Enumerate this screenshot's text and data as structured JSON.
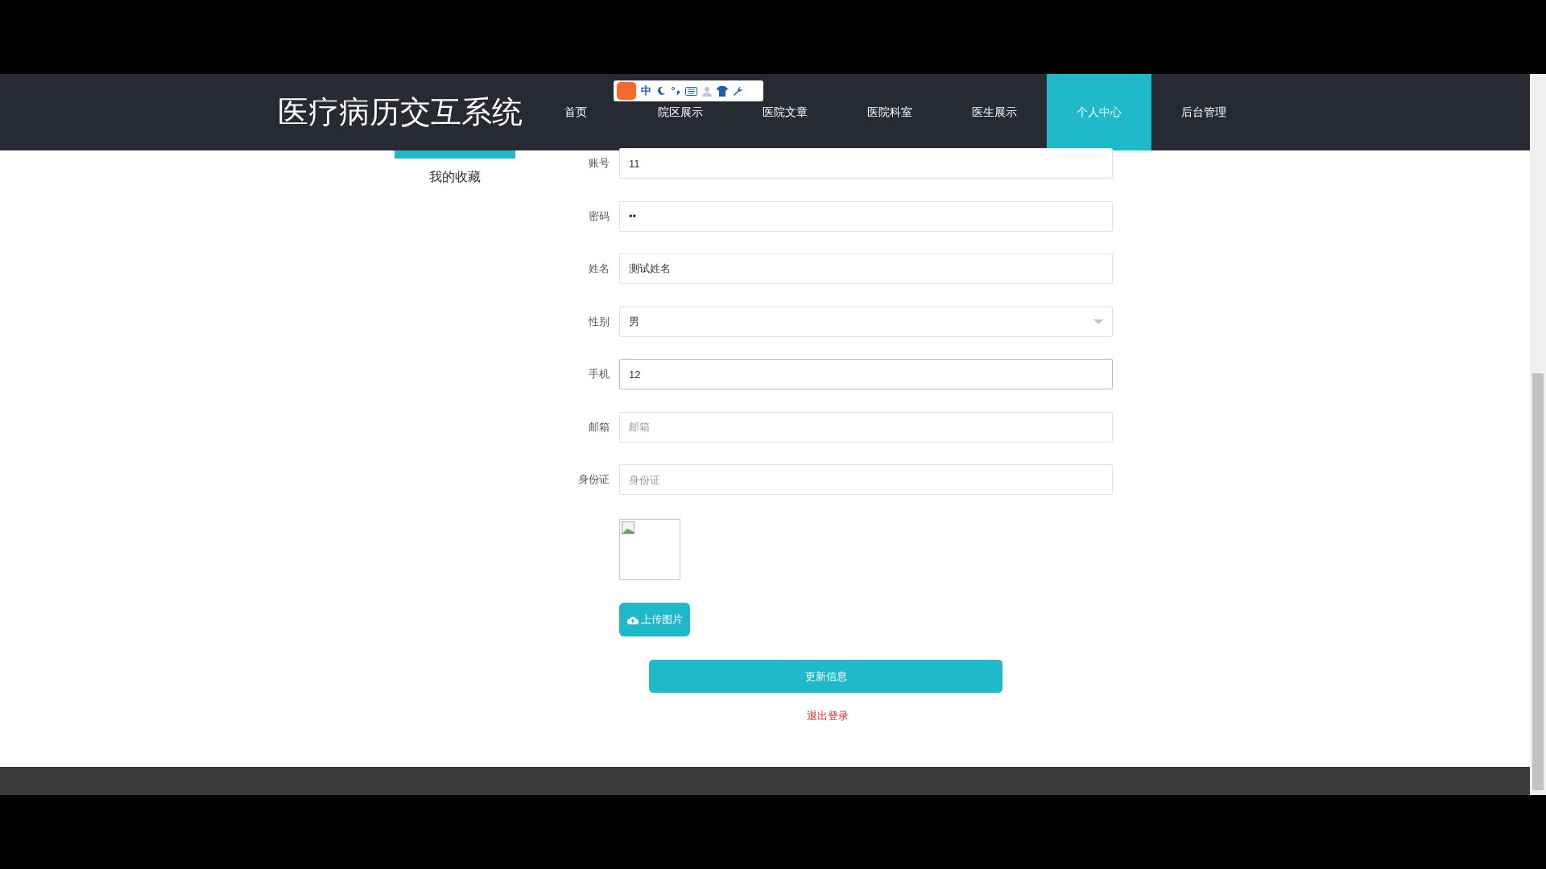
{
  "header": {
    "title": "医疗病历交互系统",
    "nav": [
      {
        "label": "首页",
        "selected": false
      },
      {
        "label": "院区展示",
        "selected": false
      },
      {
        "label": "医院文章",
        "selected": false
      },
      {
        "label": "医院科室",
        "selected": false
      },
      {
        "label": "医生展示",
        "selected": false
      },
      {
        "label": "个人中心",
        "selected": true
      },
      {
        "label": "后台管理",
        "selected": false
      }
    ]
  },
  "ime_toolbar": {
    "mode": "中"
  },
  "sidebar": {
    "items": [
      {
        "label": "我的收藏",
        "selected": false
      }
    ]
  },
  "form": {
    "fields": [
      {
        "kind": "text",
        "label": "账号",
        "value": "11",
        "focused": false
      },
      {
        "kind": "text",
        "label": "密码",
        "value": "••",
        "focused": false
      },
      {
        "kind": "text",
        "label": "姓名",
        "value": "测试姓名",
        "focused": false
      },
      {
        "kind": "select",
        "label": "性别",
        "value": "男",
        "focused": false
      },
      {
        "kind": "text",
        "label": "手机",
        "value": "12",
        "focused": true
      },
      {
        "kind": "text",
        "label": "邮箱",
        "placeholder": "邮箱",
        "focused": false
      },
      {
        "kind": "text",
        "label": "身份证",
        "placeholder": "身份证",
        "focused": false
      }
    ],
    "upload_button": "上传图片",
    "submit_button": "更新信息",
    "logout_link": "退出登录"
  }
}
